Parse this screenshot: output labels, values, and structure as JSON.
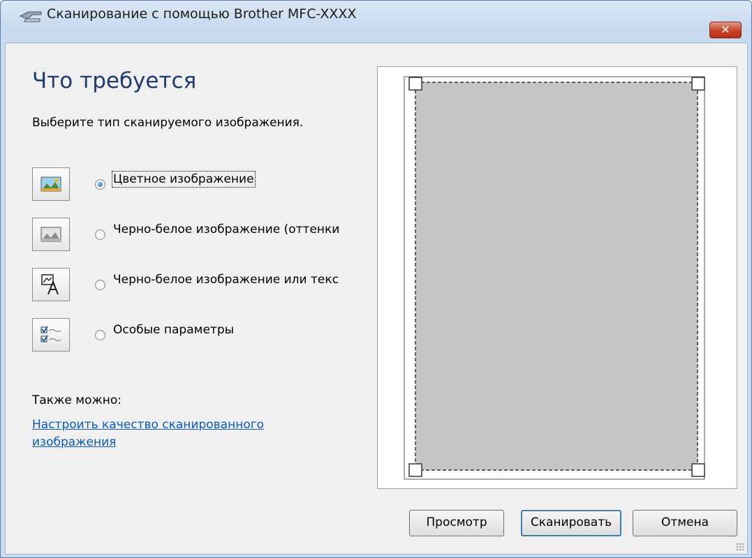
{
  "window": {
    "title": "Сканирование с помощью Brother MFC-XXXX",
    "close_glyph": "✕",
    "accent": "#1e3a6e",
    "link_color": "#0b5ab5"
  },
  "main": {
    "heading": "Что требуется",
    "subtitle": "Выберите тип сканируемого изображения.",
    "options": [
      {
        "label": "Цветное изображение",
        "icon": "color-picture-icon",
        "selected": true
      },
      {
        "label": "Черно-белое изображение (оттенки",
        "icon": "grayscale-picture-icon",
        "selected": false
      },
      {
        "label": "Черно-белое изображение или текс",
        "icon": "bw-text-icon",
        "selected": false
      },
      {
        "label": "Особые параметры",
        "icon": "custom-settings-icon",
        "selected": false
      }
    ],
    "also_label": "Также можно:",
    "quality_link": "Настроить качество сканированного изображения"
  },
  "preview": {
    "label": ""
  },
  "buttons": {
    "preview": "Просмотр",
    "scan": "Сканировать",
    "cancel": "Отмена"
  }
}
